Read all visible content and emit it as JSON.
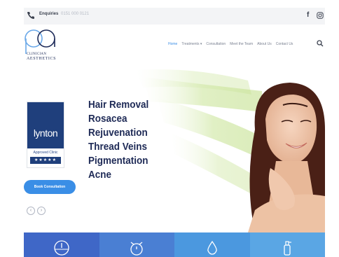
{
  "topbar": {
    "enquiries_label": "Enquiries",
    "phone": "0151 000 0121"
  },
  "header": {
    "logo_sub1": "CLINICIAN",
    "logo_sub2": "AESTHETICS"
  },
  "nav": {
    "items": [
      {
        "label": "Home"
      },
      {
        "label": "Treatments ▾"
      },
      {
        "label": "Consultation"
      },
      {
        "label": "Meet the Team"
      },
      {
        "label": "About Us"
      },
      {
        "label": "Contact Us"
      }
    ]
  },
  "badge": {
    "word": "lynton",
    "approved": "Approved Clinic",
    "stars": "★★★★★"
  },
  "hero": {
    "treatments": [
      "Hair Removal",
      "Rosacea",
      "Rejuvenation",
      "Thread Veins",
      "Pigmentation",
      "Acne"
    ],
    "cta": "Book Consultation"
  },
  "colors": {
    "accent": "#3a8ee6",
    "navy": "#1e2a56",
    "feature_tiles": [
      "#3f67c7",
      "#4a7fd3",
      "#4b98df",
      "#5aa6e4"
    ]
  },
  "features": [
    {
      "icon": "clock-icon"
    },
    {
      "icon": "alarm-icon"
    },
    {
      "icon": "drop-icon"
    },
    {
      "icon": "spray-icon"
    }
  ]
}
